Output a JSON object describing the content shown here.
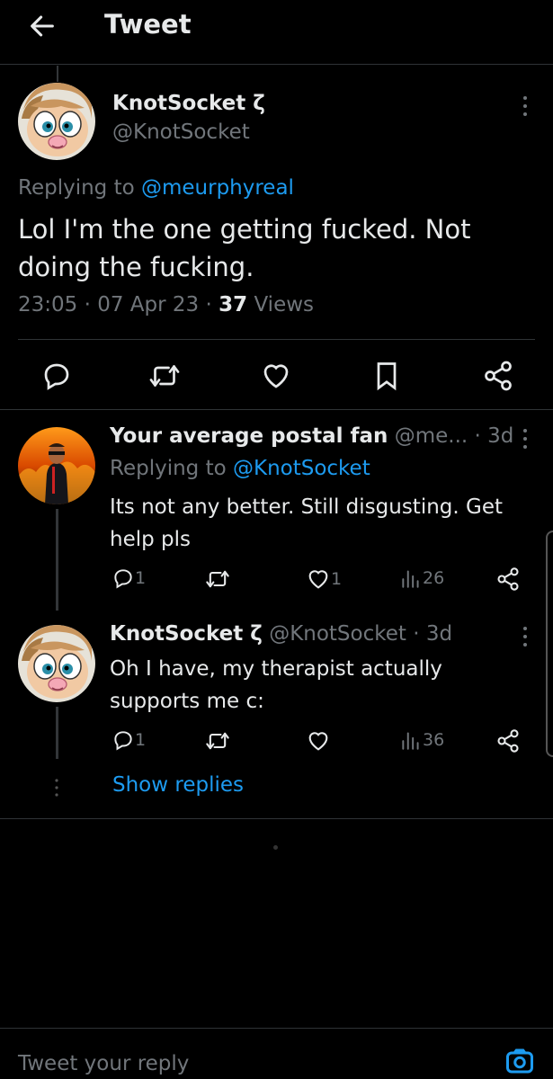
{
  "header": {
    "title": "Tweet",
    "back_icon": "arrow-left-icon"
  },
  "main_tweet": {
    "display_name": "KnotSocket ζ",
    "handle": "@KnotSocket",
    "replying_prefix": "Replying to",
    "replying_handle": "@meurphyreal",
    "text": "Lol I'm the one getting fucked. Not doing the fucking.",
    "time": "23:05",
    "date": "07 Apr 23",
    "views_count": "37",
    "views_label": "Views",
    "actions": [
      "reply-icon",
      "retweet-icon",
      "like-icon",
      "bookmark-icon",
      "share-icon"
    ]
  },
  "replies": [
    {
      "display_name": "Your average postal fan",
      "handle": "@me...",
      "age": "3d",
      "replying_prefix": "Replying to",
      "replying_handle": "@KnotSocket",
      "text": "Its not any better. Still disgusting. Get help pls",
      "reply_count": "1",
      "retweet_count": "",
      "like_count": "1",
      "view_count": "26"
    },
    {
      "display_name": "KnotSocket ζ",
      "handle": "@KnotSocket",
      "age": "3d",
      "text": "Oh I have, my therapist actually supports me c:",
      "reply_count": "1",
      "retweet_count": "",
      "like_count": "",
      "view_count": "36"
    }
  ],
  "show_replies_label": "Show replies",
  "compose": {
    "placeholder": "Tweet your reply",
    "camera_icon": "camera-icon"
  },
  "colors": {
    "background": "#000000",
    "accent": "#1d9bf0",
    "muted": "#71767b",
    "text": "#e7e9ea"
  }
}
